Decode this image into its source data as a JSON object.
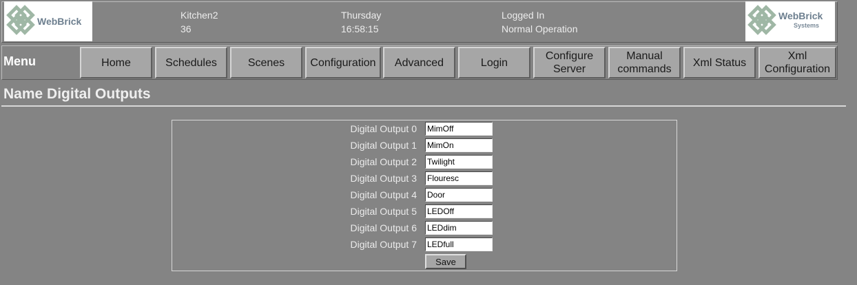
{
  "header": {
    "logo_left": {
      "brand": "WebBrick",
      "registered": "®"
    },
    "logo_right": {
      "brand": "WebBrick",
      "registered": "®",
      "sub": "Systems"
    },
    "device_name": "Kitchen2",
    "device_number": "36",
    "day": "Thursday",
    "time": "16:58:15",
    "login_status": "Logged In",
    "operation_status": "Normal Operation"
  },
  "menu": {
    "label": "Menu",
    "items": [
      {
        "label": "Home"
      },
      {
        "label": "Schedules"
      },
      {
        "label": "Scenes"
      },
      {
        "label": "Configuration"
      },
      {
        "label": "Advanced"
      },
      {
        "label": "Login"
      },
      {
        "label_line1": "Configure",
        "label_line2": "Server"
      },
      {
        "label_line1": "Manual",
        "label_line2": "commands"
      },
      {
        "label": "Xml Status"
      },
      {
        "label_line1": "Xml",
        "label_line2": "Configuration"
      }
    ]
  },
  "page_title": "Name Digital Outputs",
  "outputs": [
    {
      "label": "Digital Output 0",
      "value": "MimOff"
    },
    {
      "label": "Digital Output 1",
      "value": "MimOn"
    },
    {
      "label": "Digital Output 2",
      "value": "Twilight"
    },
    {
      "label": "Digital Output 3",
      "value": "Flouresc"
    },
    {
      "label": "Digital Output 4",
      "value": "Door"
    },
    {
      "label": "Digital Output 5",
      "value": "LEDOff"
    },
    {
      "label": "Digital Output 6",
      "value": "LEDdim"
    },
    {
      "label": "Digital Output 7",
      "value": "LEDfull"
    }
  ],
  "save_label": "Save",
  "colors": {
    "background": "#848484",
    "button_face": "#a6a6a6",
    "logo_brand": "#6d7f8f"
  }
}
